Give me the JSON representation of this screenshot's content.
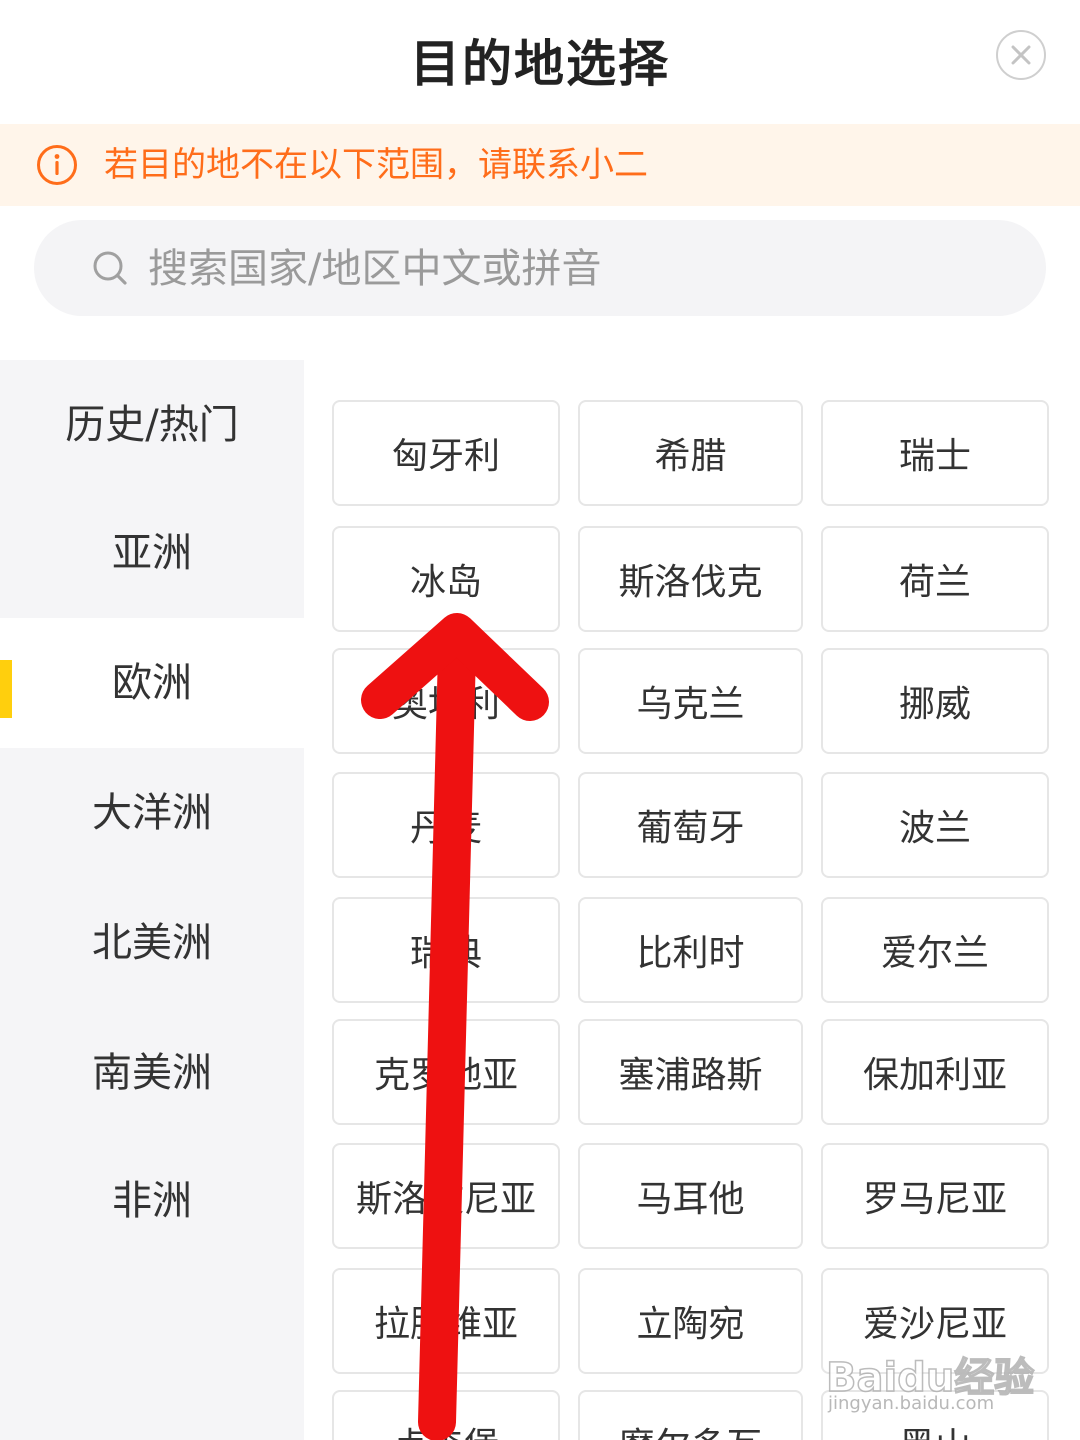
{
  "header": {
    "title": "目的地选择",
    "close_icon": "close-icon"
  },
  "notice": {
    "icon": "info-icon",
    "text": "若目的地不在以下范围，请联系小二",
    "color": "#ff6d1a"
  },
  "search": {
    "placeholder": "搜索国家/地区中文或拼音"
  },
  "sidebar": {
    "items": [
      {
        "label": "历史/热门"
      },
      {
        "label": "亚洲"
      },
      {
        "label": "欧洲",
        "active": true
      },
      {
        "label": "大洋洲"
      },
      {
        "label": "北美洲"
      },
      {
        "label": "南美洲"
      },
      {
        "label": "非洲"
      }
    ],
    "accent": "#ffcf0d"
  },
  "grid": {
    "rows": [
      [
        "",
        "",
        ""
      ],
      [
        "匈牙利",
        "希腊",
        "瑞士"
      ],
      [
        "冰岛",
        "斯洛伐克",
        "荷兰"
      ],
      [
        "奥地利",
        "乌克兰",
        "挪威"
      ],
      [
        "丹麦",
        "葡萄牙",
        "波兰"
      ],
      [
        "瑞典",
        "比利时",
        "爱尔兰"
      ],
      [
        "克罗地亚",
        "塞浦路斯",
        "保加利亚"
      ],
      [
        "斯洛文尼亚",
        "马耳他",
        "罗马尼亚"
      ],
      [
        "拉脱维亚",
        "立陶宛",
        "爱沙尼亚"
      ],
      [
        "卢森堡",
        "摩尔多瓦",
        "黑山"
      ]
    ]
  },
  "overlay": {
    "arrow_color": "#ee1111"
  },
  "watermark": {
    "brand": "Baidu经验",
    "url": "jingyan.baidu.com"
  }
}
